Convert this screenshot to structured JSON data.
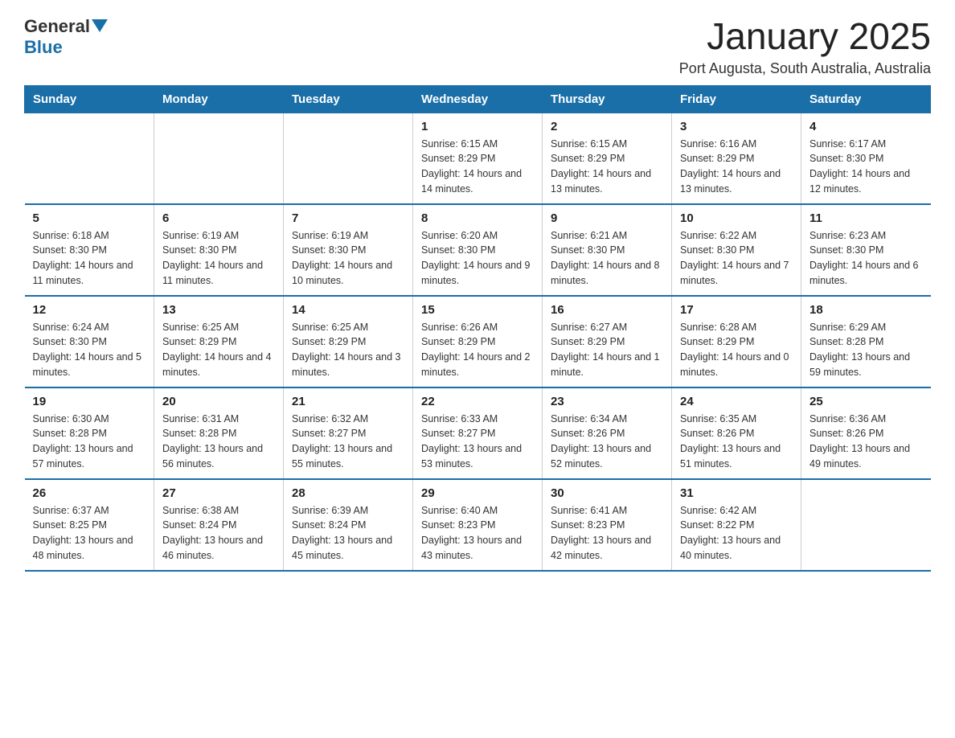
{
  "logo": {
    "text_general": "General",
    "text_blue": "Blue",
    "arrow_title": "GeneralBlue logo"
  },
  "header": {
    "title": "January 2025",
    "subtitle": "Port Augusta, South Australia, Australia"
  },
  "weekdays": [
    "Sunday",
    "Monday",
    "Tuesday",
    "Wednesday",
    "Thursday",
    "Friday",
    "Saturday"
  ],
  "weeks": [
    [
      {
        "day": "",
        "info": ""
      },
      {
        "day": "",
        "info": ""
      },
      {
        "day": "",
        "info": ""
      },
      {
        "day": "1",
        "info": "Sunrise: 6:15 AM\nSunset: 8:29 PM\nDaylight: 14 hours\nand 14 minutes."
      },
      {
        "day": "2",
        "info": "Sunrise: 6:15 AM\nSunset: 8:29 PM\nDaylight: 14 hours\nand 13 minutes."
      },
      {
        "day": "3",
        "info": "Sunrise: 6:16 AM\nSunset: 8:29 PM\nDaylight: 14 hours\nand 13 minutes."
      },
      {
        "day": "4",
        "info": "Sunrise: 6:17 AM\nSunset: 8:30 PM\nDaylight: 14 hours\nand 12 minutes."
      }
    ],
    [
      {
        "day": "5",
        "info": "Sunrise: 6:18 AM\nSunset: 8:30 PM\nDaylight: 14 hours\nand 11 minutes."
      },
      {
        "day": "6",
        "info": "Sunrise: 6:19 AM\nSunset: 8:30 PM\nDaylight: 14 hours\nand 11 minutes."
      },
      {
        "day": "7",
        "info": "Sunrise: 6:19 AM\nSunset: 8:30 PM\nDaylight: 14 hours\nand 10 minutes."
      },
      {
        "day": "8",
        "info": "Sunrise: 6:20 AM\nSunset: 8:30 PM\nDaylight: 14 hours\nand 9 minutes."
      },
      {
        "day": "9",
        "info": "Sunrise: 6:21 AM\nSunset: 8:30 PM\nDaylight: 14 hours\nand 8 minutes."
      },
      {
        "day": "10",
        "info": "Sunrise: 6:22 AM\nSunset: 8:30 PM\nDaylight: 14 hours\nand 7 minutes."
      },
      {
        "day": "11",
        "info": "Sunrise: 6:23 AM\nSunset: 8:30 PM\nDaylight: 14 hours\nand 6 minutes."
      }
    ],
    [
      {
        "day": "12",
        "info": "Sunrise: 6:24 AM\nSunset: 8:30 PM\nDaylight: 14 hours\nand 5 minutes."
      },
      {
        "day": "13",
        "info": "Sunrise: 6:25 AM\nSunset: 8:29 PM\nDaylight: 14 hours\nand 4 minutes."
      },
      {
        "day": "14",
        "info": "Sunrise: 6:25 AM\nSunset: 8:29 PM\nDaylight: 14 hours\nand 3 minutes."
      },
      {
        "day": "15",
        "info": "Sunrise: 6:26 AM\nSunset: 8:29 PM\nDaylight: 14 hours\nand 2 minutes."
      },
      {
        "day": "16",
        "info": "Sunrise: 6:27 AM\nSunset: 8:29 PM\nDaylight: 14 hours\nand 1 minute."
      },
      {
        "day": "17",
        "info": "Sunrise: 6:28 AM\nSunset: 8:29 PM\nDaylight: 14 hours\nand 0 minutes."
      },
      {
        "day": "18",
        "info": "Sunrise: 6:29 AM\nSunset: 8:28 PM\nDaylight: 13 hours\nand 59 minutes."
      }
    ],
    [
      {
        "day": "19",
        "info": "Sunrise: 6:30 AM\nSunset: 8:28 PM\nDaylight: 13 hours\nand 57 minutes."
      },
      {
        "day": "20",
        "info": "Sunrise: 6:31 AM\nSunset: 8:28 PM\nDaylight: 13 hours\nand 56 minutes."
      },
      {
        "day": "21",
        "info": "Sunrise: 6:32 AM\nSunset: 8:27 PM\nDaylight: 13 hours\nand 55 minutes."
      },
      {
        "day": "22",
        "info": "Sunrise: 6:33 AM\nSunset: 8:27 PM\nDaylight: 13 hours\nand 53 minutes."
      },
      {
        "day": "23",
        "info": "Sunrise: 6:34 AM\nSunset: 8:26 PM\nDaylight: 13 hours\nand 52 minutes."
      },
      {
        "day": "24",
        "info": "Sunrise: 6:35 AM\nSunset: 8:26 PM\nDaylight: 13 hours\nand 51 minutes."
      },
      {
        "day": "25",
        "info": "Sunrise: 6:36 AM\nSunset: 8:26 PM\nDaylight: 13 hours\nand 49 minutes."
      }
    ],
    [
      {
        "day": "26",
        "info": "Sunrise: 6:37 AM\nSunset: 8:25 PM\nDaylight: 13 hours\nand 48 minutes."
      },
      {
        "day": "27",
        "info": "Sunrise: 6:38 AM\nSunset: 8:24 PM\nDaylight: 13 hours\nand 46 minutes."
      },
      {
        "day": "28",
        "info": "Sunrise: 6:39 AM\nSunset: 8:24 PM\nDaylight: 13 hours\nand 45 minutes."
      },
      {
        "day": "29",
        "info": "Sunrise: 6:40 AM\nSunset: 8:23 PM\nDaylight: 13 hours\nand 43 minutes."
      },
      {
        "day": "30",
        "info": "Sunrise: 6:41 AM\nSunset: 8:23 PM\nDaylight: 13 hours\nand 42 minutes."
      },
      {
        "day": "31",
        "info": "Sunrise: 6:42 AM\nSunset: 8:22 PM\nDaylight: 13 hours\nand 40 minutes."
      },
      {
        "day": "",
        "info": ""
      }
    ]
  ]
}
